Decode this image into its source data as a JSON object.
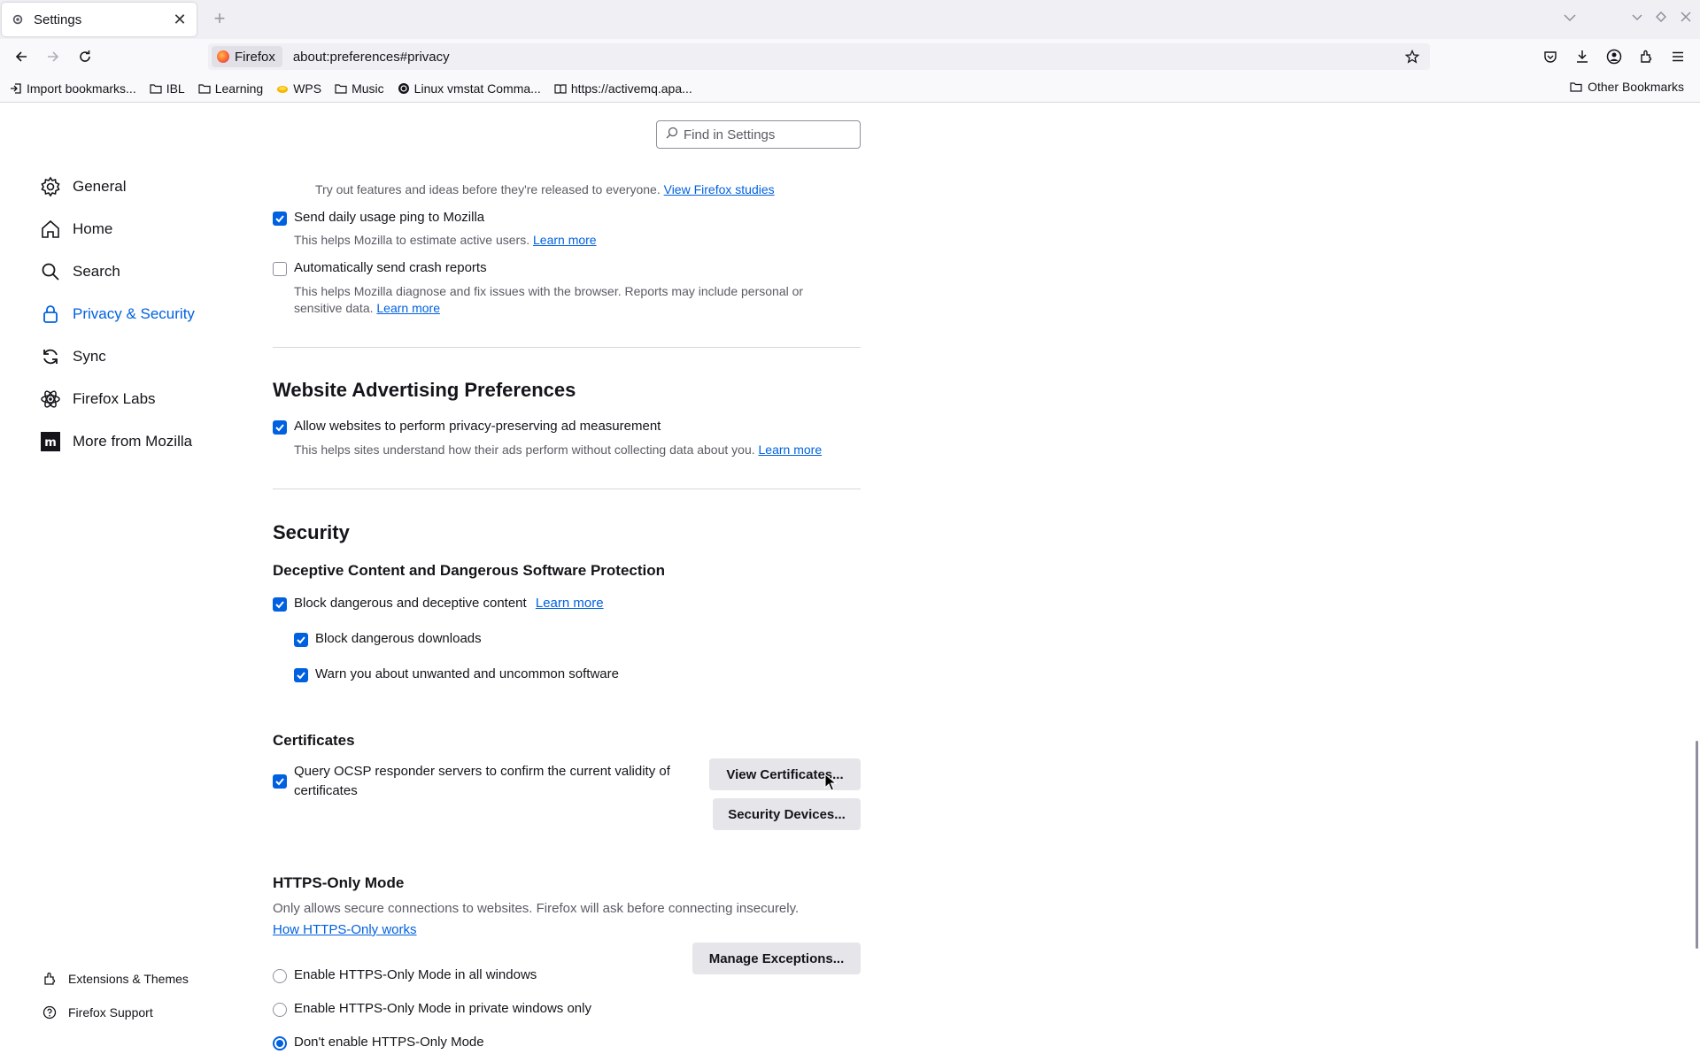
{
  "tab": {
    "title": "Settings",
    "close": "✕",
    "new": "+"
  },
  "nav": {
    "identity": "Firefox",
    "url": "about:preferences#privacy"
  },
  "bookmarks": [
    {
      "label": "Import bookmarks...",
      "icon": "import-icon"
    },
    {
      "label": "IBL",
      "icon": "folder-icon"
    },
    {
      "label": "Learning",
      "icon": "folder-icon"
    },
    {
      "label": "WPS",
      "icon": "wps-icon"
    },
    {
      "label": "Music",
      "icon": "folder-icon"
    },
    {
      "label": "Linux vmstat Comma...",
      "icon": "site-icon"
    },
    {
      "label": "https://activemq.apa...",
      "icon": "book-icon"
    }
  ],
  "bookmarks_other": "Other Bookmarks",
  "search": {
    "placeholder": "Find in Settings"
  },
  "sidebar": {
    "items": [
      {
        "label": "General",
        "icon": "gear-icon"
      },
      {
        "label": "Home",
        "icon": "home-icon"
      },
      {
        "label": "Search",
        "icon": "search-icon"
      },
      {
        "label": "Privacy & Security",
        "icon": "lock-icon",
        "active": true
      },
      {
        "label": "Sync",
        "icon": "sync-icon"
      },
      {
        "label": "Firefox Labs",
        "icon": "labs-icon"
      },
      {
        "label": "More from Mozilla",
        "icon": "mozilla-icon"
      }
    ],
    "footer": {
      "extensions": "Extensions & Themes",
      "support": "Firefox Support"
    }
  },
  "main": {
    "studies_text": "Try out features and ideas before they're released to everyone.",
    "studies_link": "View Firefox studies",
    "usage_ping": "Send daily usage ping to Mozilla",
    "usage_ping_desc": "This helps Mozilla to estimate active users.",
    "learn_more": "Learn more",
    "crash_reports": "Automatically send crash reports",
    "crash_desc_1": "This helps Mozilla diagnose and fix issues with the browser. Reports may include personal or",
    "crash_desc_2": "sensitive data.",
    "ad_heading": "Website Advertising Preferences",
    "ad_allow": "Allow websites to perform privacy-preserving ad measurement",
    "ad_desc": "This helps sites understand how their ads perform without collecting data about you.",
    "security_heading": "Security",
    "deceptive_heading": "Deceptive Content and Dangerous Software Protection",
    "block_dangerous": "Block dangerous and deceptive content",
    "block_downloads": "Block dangerous downloads",
    "warn_unwanted": "Warn you about unwanted and uncommon software",
    "certs_heading": "Certificates",
    "ocsp_1": "Query OCSP responder servers to confirm the current validity of",
    "ocsp_2": "certificates",
    "view_certs": "View Certificates...",
    "security_devices": "Security Devices...",
    "https_heading": "HTTPS-Only Mode",
    "https_desc": "Only allows secure connections to websites. Firefox will ask before connecting insecurely.",
    "https_link": "How HTTPS-Only works",
    "manage_exceptions": "Manage Exceptions...",
    "https_all": "Enable HTTPS-Only Mode in all windows",
    "https_private": "Enable HTTPS-Only Mode in private windows only",
    "https_none": "Don't enable HTTPS-Only Mode"
  },
  "colors": {
    "accent": "#0061e0",
    "text": "#15141a",
    "muted": "#5b5b66"
  }
}
